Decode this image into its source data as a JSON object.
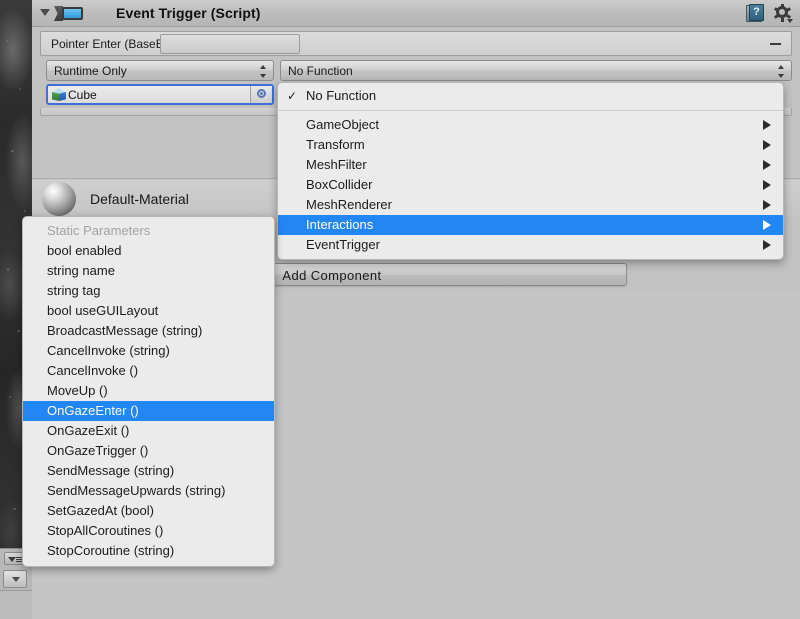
{
  "component": {
    "title": "Event Trigger (Script)",
    "foldout_icon": "foldout-triangle-down-icon",
    "script_icon": "script-icon",
    "help_icon": "help-book-icon",
    "gear_icon": "gear-icon"
  },
  "event_entry": {
    "title": "Pointer Enter (BaseEventData)",
    "remove_icon": "minus-icon",
    "runtime_mode": "Runtime Only",
    "function_value": "No Function",
    "object_value": "Cube",
    "object_icon": "cube-icon",
    "picker_icon": "object-picker-icon"
  },
  "material": {
    "name": "Default-Material",
    "preview_icon": "material-sphere-preview"
  },
  "add_component": {
    "label": "Add Component"
  },
  "function_menu": {
    "no_function": {
      "label": "No Function",
      "checked": true
    },
    "items": [
      {
        "label": "GameObject",
        "submenu": true,
        "selected": false
      },
      {
        "label": "Transform",
        "submenu": true,
        "selected": false
      },
      {
        "label": "MeshFilter",
        "submenu": true,
        "selected": false
      },
      {
        "label": "BoxCollider",
        "submenu": true,
        "selected": false
      },
      {
        "label": "MeshRenderer",
        "submenu": true,
        "selected": false
      },
      {
        "label": "Interactions",
        "submenu": true,
        "selected": true
      },
      {
        "label": "EventTrigger",
        "submenu": true,
        "selected": false
      }
    ]
  },
  "params_menu": {
    "items": [
      {
        "label": "Static Parameters",
        "header": true,
        "selected": false
      },
      {
        "label": "bool enabled",
        "header": false,
        "selected": false
      },
      {
        "label": "string name",
        "header": false,
        "selected": false
      },
      {
        "label": "string tag",
        "header": false,
        "selected": false
      },
      {
        "label": "bool useGUILayout",
        "header": false,
        "selected": false
      },
      {
        "label": "BroadcastMessage (string)",
        "header": false,
        "selected": false
      },
      {
        "label": "CancelInvoke (string)",
        "header": false,
        "selected": false
      },
      {
        "label": "CancelInvoke ()",
        "header": false,
        "selected": false
      },
      {
        "label": "MoveUp ()",
        "header": false,
        "selected": false
      },
      {
        "label": "OnGazeEnter ()",
        "header": false,
        "selected": true
      },
      {
        "label": "OnGazeExit ()",
        "header": false,
        "selected": false
      },
      {
        "label": "OnGazeTrigger ()",
        "header": false,
        "selected": false
      },
      {
        "label": "SendMessage (string)",
        "header": false,
        "selected": false
      },
      {
        "label": "SendMessageUpwards (string)",
        "header": false,
        "selected": false
      },
      {
        "label": "SetGazedAt (bool)",
        "header": false,
        "selected": false
      },
      {
        "label": "StopAllCoroutines ()",
        "header": false,
        "selected": false
      },
      {
        "label": "StopCoroutine (string)",
        "header": false,
        "selected": false
      }
    ]
  },
  "colors": {
    "menu_highlight": "#2287f5",
    "focus_border": "#3f6fd8",
    "panel_bg": "#c2c2c2",
    "menu_bg": "#ebebeb"
  }
}
